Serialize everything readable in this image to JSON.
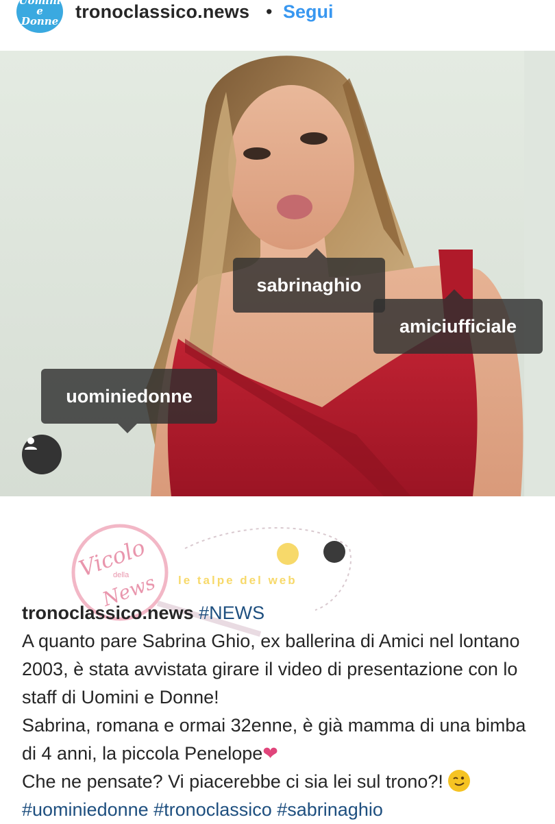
{
  "header": {
    "avatar_text": "Uomini e Donne",
    "username": "tronoclassico.news",
    "separator": "•",
    "follow_label": "Segui"
  },
  "photo_tags": {
    "tag1": "sabrinaghio",
    "tag2": "amiciufficiale",
    "tag3": "uominiedonne"
  },
  "watermark": {
    "left_text": "Vicolo delle News",
    "right_text": "le talpe del web"
  },
  "caption": {
    "username": "tronoclassico.news",
    "first_hashtag": "#NEWS",
    "line1": "A quanto pare Sabrina Ghio, ex ballerina di Amici nel lontano 2003, è stata avvistata girare il video di presentazione con lo staff di Uomini e Donne!",
    "line2": "Sabrina, romana e ormai 32enne, è già mamma di una bimba di 4 anni, la piccola Penelope",
    "heart": "❤",
    "line3": "Che ne pensate? Vi piacerebbe ci sia lei sul trono?!",
    "hashtags": "#uominiedonne #tronoclassico #sabrinaghio"
  },
  "colors": {
    "accent": "#3897f0",
    "hashtag": "#1e4f7f",
    "dress": "#b01a2a",
    "avatar_bg": "#3aa9e0"
  }
}
